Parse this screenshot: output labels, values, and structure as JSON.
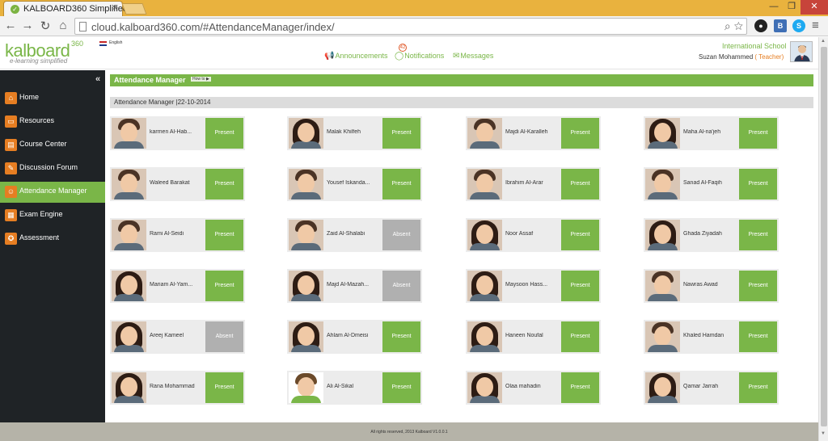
{
  "browser": {
    "tab_title": "KALBOARD360 Simplified",
    "tab_close": "×",
    "url": "cloud.kalboard360.com/#AttendanceManager/index/",
    "window_min": "—",
    "window_max": "❐",
    "window_close": "✕"
  },
  "header": {
    "logo": "kalboard",
    "logo_sup": "360",
    "logo_sub": "e-learning simplified",
    "language": "English",
    "nav": [
      {
        "label": "Announcements",
        "icon": "megaphone-icon"
      },
      {
        "label": "Notifications",
        "icon": "comment-icon",
        "badge": "42"
      },
      {
        "label": "Messages",
        "icon": "envelope-icon"
      }
    ],
    "school": "International School",
    "user": "Suzan Mohammed",
    "role": "( Teacher)"
  },
  "sidebar": {
    "collapse": "«",
    "items": [
      {
        "label": "Home",
        "icon": "home-icon",
        "glyph": "⌂",
        "active": false
      },
      {
        "label": "Resources",
        "icon": "folder-icon",
        "glyph": "▭",
        "active": false
      },
      {
        "label": "Course Center",
        "icon": "course-icon",
        "glyph": "▤",
        "active": false
      },
      {
        "label": "Discussion Forum",
        "icon": "forum-icon",
        "glyph": "✎",
        "active": false
      },
      {
        "label": "Attendance Manager",
        "icon": "attendance-icon",
        "glyph": "☺",
        "active": true
      },
      {
        "label": "Exam Engine",
        "icon": "exam-icon",
        "glyph": "▦",
        "active": false
      },
      {
        "label": "Assessment",
        "icon": "assessment-icon",
        "glyph": "✪",
        "active": false
      }
    ]
  },
  "main": {
    "title": "Attendance Manager",
    "howto": "How to ▶",
    "subtitle": "Attendance Manager |22-10-2014"
  },
  "students": [
    {
      "name": "karmen Al-Hab...",
      "status": "Present",
      "photo": "boy"
    },
    {
      "name": "Malak Khilfeh",
      "status": "Present",
      "photo": "girl"
    },
    {
      "name": "Majdi Al-Karalleh",
      "status": "Present",
      "photo": "boy"
    },
    {
      "name": "Maha Al-na'jeh",
      "status": "Present",
      "photo": "girl"
    },
    {
      "name": "Waleed Barakat",
      "status": "Present",
      "photo": "boy"
    },
    {
      "name": "Yousef Iskanda...",
      "status": "Present",
      "photo": "boy"
    },
    {
      "name": "Ibrahim Al-Arar",
      "status": "Present",
      "photo": "boy"
    },
    {
      "name": "Sanad Al-Faqih",
      "status": "Present",
      "photo": "boy"
    },
    {
      "name": "Rami Al-Seidi",
      "status": "Present",
      "photo": "boy"
    },
    {
      "name": "Zaid Al-Shalabi",
      "status": "Absent",
      "photo": "boy"
    },
    {
      "name": "Noor Assaf",
      "status": "Present",
      "photo": "girl"
    },
    {
      "name": "Ghada Ziyadah",
      "status": "Present",
      "photo": "girl"
    },
    {
      "name": "Mariam Al-Yam...",
      "status": "Present",
      "photo": "girl"
    },
    {
      "name": "Majd Al-Mazah...",
      "status": "Absent",
      "photo": "girl"
    },
    {
      "name": "Maysoon Hass...",
      "status": "Present",
      "photo": "girl"
    },
    {
      "name": "Nawras Awad",
      "status": "Present",
      "photo": "boy"
    },
    {
      "name": "Areej Kameel",
      "status": "Absent",
      "photo": "girl"
    },
    {
      "name": "Ahlam Al-Dmeisi",
      "status": "Present",
      "photo": "girl"
    },
    {
      "name": "Haneen Noufal",
      "status": "Present",
      "photo": "girl"
    },
    {
      "name": "Khaled Hamdan",
      "status": "Present",
      "photo": "boy"
    },
    {
      "name": "Rana Mohammad",
      "status": "Present",
      "photo": "girl"
    },
    {
      "name": "Ali Al-Sikal",
      "status": "Present",
      "photo": "avatar"
    },
    {
      "name": "Olaa mahadin",
      "status": "Present",
      "photo": "girl"
    },
    {
      "name": "Qamar Jarrah",
      "status": "Present",
      "photo": "girl"
    }
  ],
  "footer": {
    "text": "All rights reserved, 2013 Kalboard V1.0.0.1"
  },
  "colors": {
    "accent": "#7ab648",
    "absent": "#b0b0b0",
    "sidebar": "#1f2326",
    "icon": "#e67e22"
  }
}
